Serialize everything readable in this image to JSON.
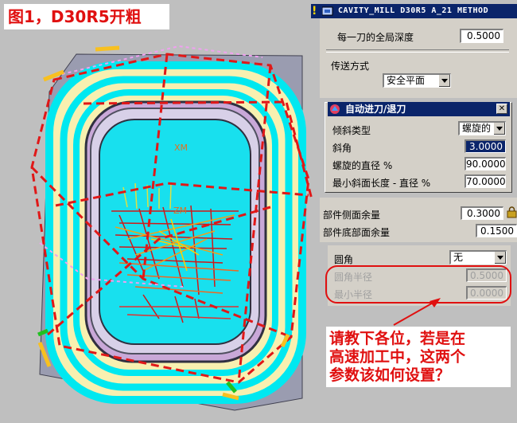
{
  "figure_title": "图1，D30R5开粗",
  "canvas": {
    "labels": {
      "xm": "XM",
      "zm": "ZM"
    }
  },
  "method_window": {
    "title": "CAVITY_MILL  D30R5    A_21   METHOD",
    "global_depth_label": "每一刀的全局深度",
    "global_depth_value": "0.5000",
    "transfer_label": "传送方式",
    "transfer_value": "安全平面",
    "side_stock_label": "部件侧面余量",
    "side_stock_value": "0.3000",
    "floor_stock_label": "部件底部面余量",
    "floor_stock_value": "0.1500",
    "corner_label": "圆角",
    "corner_value": "无",
    "corner_radius_label": "圆角半径",
    "corner_radius_value": "0.5000",
    "min_radius_label": "最小半径",
    "min_radius_value": "0.0000"
  },
  "engage_dialog": {
    "title": "自动进刀/退刀",
    "ramp_type_label": "倾斜类型",
    "ramp_type_value": "螺旋的",
    "angle_label": "斜角",
    "angle_value": "3.0000",
    "helix_dia_label": "螺旋的直径 %",
    "helix_dia_value": "90.0000",
    "min_ramp_label": "最小斜面长度 - 直径 %",
    "min_ramp_value": "70.0000"
  },
  "callout": {
    "line1": "请教下各位，若是在",
    "line2": "高速加工中，这两个",
    "line3": "参数该如何设置？"
  },
  "colors": {
    "accent": "#e01010",
    "titlebar": "#0a246a",
    "toolpath_cyan": "#00e8f0",
    "stock_yellow": "#f8f0b0"
  }
}
